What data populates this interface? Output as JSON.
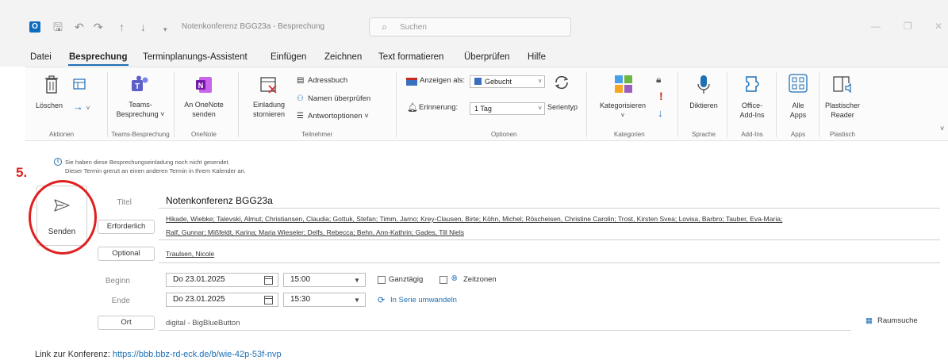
{
  "window": {
    "title": "Notenkonferenz BGG23a  -  Besprechung",
    "search_placeholder": "Suchen"
  },
  "menu": {
    "items": [
      "Datei",
      "Besprechung",
      "Terminplanungs-Assistent",
      "Einfügen",
      "Zeichnen",
      "Text formatieren",
      "Überprüfen",
      "Hilfe"
    ],
    "active_index": 1
  },
  "ribbon": {
    "delete": "Löschen",
    "teams_line1": "Teams-",
    "teams_line2": "Besprechung ˅",
    "onenote_line1": "An OneNote",
    "onenote_line2": "senden",
    "cancel_line1": "Einladung",
    "cancel_line2": "stornieren",
    "address_book": "Adressbuch",
    "check_names": "Namen überprüfen",
    "response_options": "Antwortoptionen ˅",
    "show_as_label": "Anzeigen als:",
    "show_as_value": "Gebucht",
    "reminder_label": "Erinnerung:",
    "reminder_value": "1 Tag",
    "series": "Serientyp",
    "categorize": "Kategorisieren",
    "categorize_arrow": "˅",
    "dictate": "Diktieren",
    "office_line1": "Office-",
    "office_line2": "Add-Ins",
    "apps_line1": "Alle",
    "apps_line2": "Apps",
    "reader_line1": "Plastischer",
    "reader_line2": "Reader",
    "groups": [
      "Aktionen",
      "Teams-Besprechung",
      "OneNote",
      "Teilnehmer",
      "Optionen",
      "Kategorien",
      "Sprache",
      "Add-Ins",
      "Apps",
      "Plastisch"
    ]
  },
  "info": {
    "line1": "Sie haben diese Besprechungseinladung noch nicht gesendet.",
    "line2": "Dieser Termin grenzt an einen anderen Termin in Ihrem Kalender an."
  },
  "step_number": "5.",
  "send_label": "Senden",
  "form": {
    "title_label": "Titel",
    "title_value": "Notenkonferenz BGG23a",
    "required_button": "Erforderlich",
    "required_line1": "Hikade, Wiebke; Talevski, Almut; Christiansen, Claudia; Gottuk, Stefan; Timm, Jarno; Krey-Clausen, Birte; Köhn, Michel; Röscheisen, Christine Carolin; Trost, Kirsten Svea; Lovisa, Barbro; Tauber, Eva-Maria;",
    "required_line2": "Ralf, Gunnar; Mißfeldt, Karina; Maria Wieseler; Delfs, Rebecca; Behn, Ann-Kathrin; Gades, Till Niels",
    "optional_button": "Optional",
    "optional_value": "Traulsen, Nicole",
    "start_label": "Beginn",
    "start_date": "Do 23.01.2025",
    "start_time": "15:00",
    "allday_label": "Ganztägig",
    "timezones_label": "Zeitzonen",
    "end_label": "Ende",
    "end_date": "Do 23.01.2025",
    "end_time": "15:30",
    "recurring_link": "In Serie umwandeln",
    "location_button": "Ort",
    "location_value": "digital - BigBlueButton",
    "room_search": "Raumsuche"
  },
  "body": {
    "link_label": "Link zur Konferenz:",
    "link_url": "https://bbb.bbz-rd-eck.de/b/wie-42p-53f-nvp"
  }
}
